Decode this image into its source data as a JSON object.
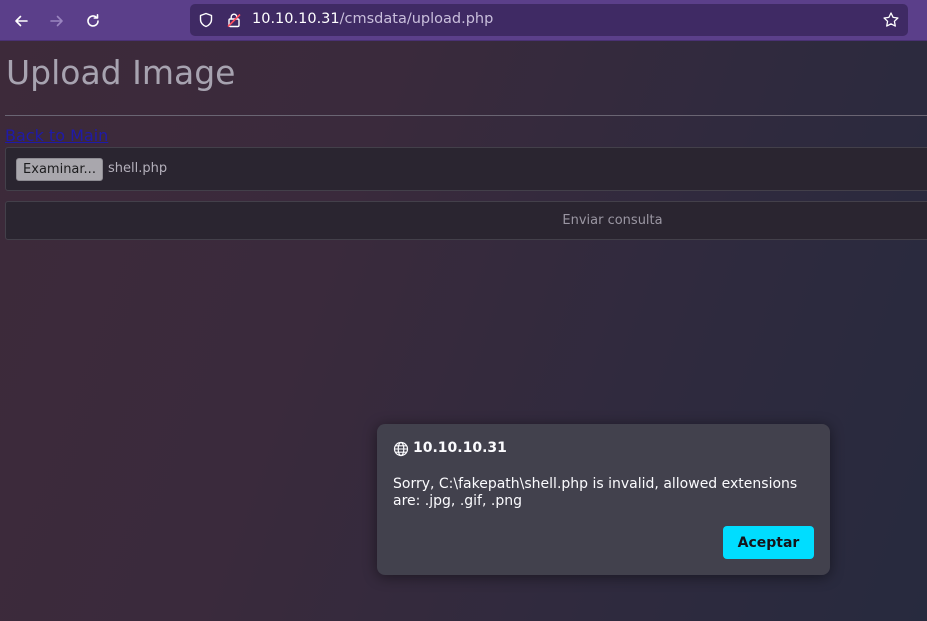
{
  "browser": {
    "url_host": "10.10.10.31",
    "url_path": "/cmsdata/upload.php",
    "icons": [
      "back-arrow-icon",
      "forward-arrow-icon",
      "reload-icon",
      "shield-icon",
      "lock-icon",
      "star-icon"
    ],
    "accent": "#5b3f8a"
  },
  "page": {
    "title": "Upload Image",
    "back_link": "Back to Main",
    "file_button": "Examinar...",
    "file_name": "shell.php",
    "submit_label": "Enviar consulta"
  },
  "dialog": {
    "host": "10.10.10.31",
    "message": "Sorry, C:\\fakepath\\shell.php is invalid, allowed extensions are: .jpg, .gif, .png",
    "ok_label": "Aceptar",
    "ok_color": "#00ddff"
  }
}
